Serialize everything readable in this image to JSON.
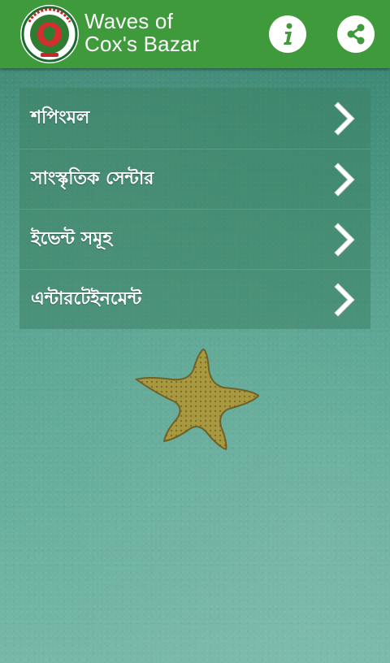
{
  "app": {
    "title_line1": "Waves of",
    "title_line2": "Cox's Bazar"
  },
  "header": {
    "info_icon": "info-icon",
    "share_icon": "share-icon",
    "logo_icon": "government-seal-logo"
  },
  "menu": {
    "items": [
      {
        "label": "শপিংমল"
      },
      {
        "label": "সাংস্কৃতিক সেন্টার"
      },
      {
        "label": "ইভেন্ট সমূহ"
      },
      {
        "label": "এন্টারটেইনমেন্ট"
      }
    ],
    "chevron_icon": "chevron-right-icon"
  },
  "colors": {
    "appbar": "#3f9a3c",
    "background": "#4f9a87",
    "text": "#ffffff"
  }
}
